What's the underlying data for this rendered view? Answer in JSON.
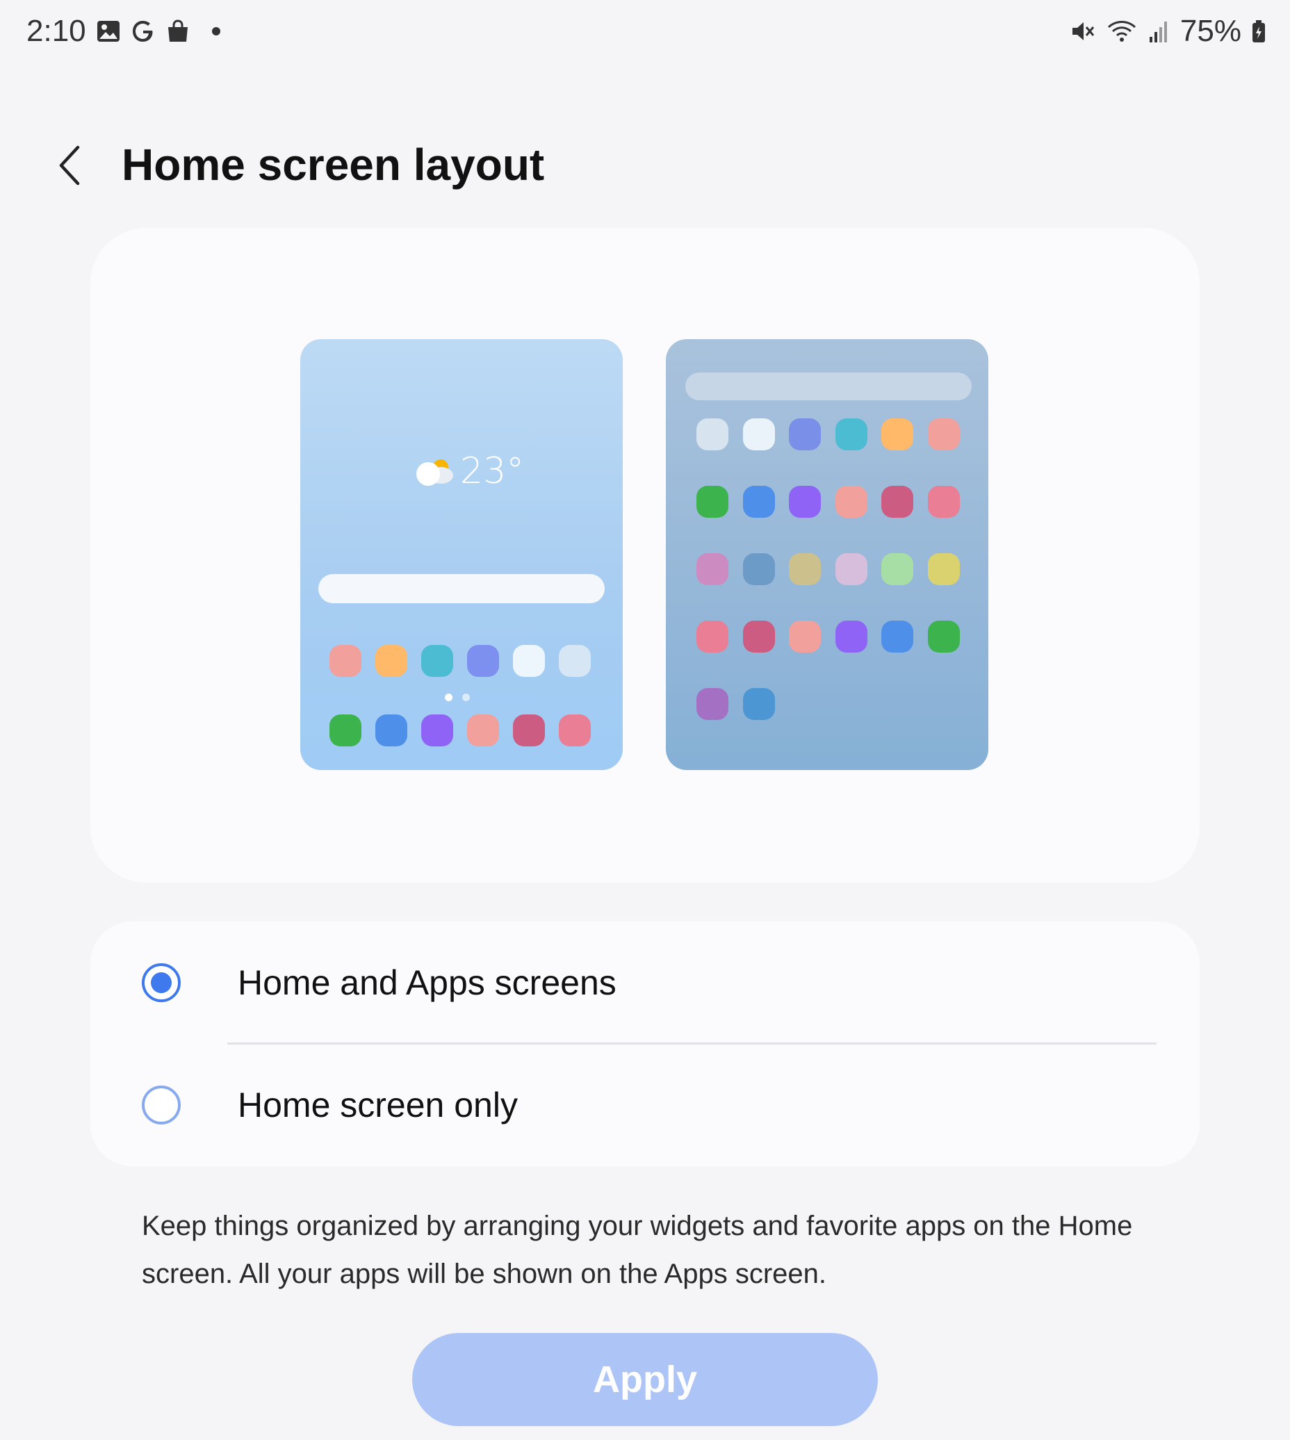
{
  "status_bar": {
    "time": "2:10",
    "left_icons": [
      "gallery-icon",
      "google-icon",
      "shopping-bag-icon",
      "notification-dot-icon"
    ],
    "right_icons": [
      "mute-icon",
      "wifi-icon",
      "signal-icon"
    ],
    "battery": "75%"
  },
  "header": {
    "back_icon": "back-chevron-icon",
    "title": "Home screen layout"
  },
  "preview": {
    "weather_temp": "23°",
    "home_row1_colors": [
      "#f2a09b",
      "#ffb968",
      "#4bbcd2",
      "#7d8fef",
      "#eef6fd",
      "#d6e6f4"
    ],
    "home_row2_colors": [
      "#3cb34d",
      "#4e8fea",
      "#8e63f5",
      "#f2a09b",
      "#cc5c82",
      "#e97e95"
    ],
    "apps_grid_colors": [
      "#d7e4ef",
      "#eaf3fa",
      "#7a8fe8",
      "#4bbcd2",
      "#ffb968",
      "#f2a09b",
      "#3cb34d",
      "#4e8fea",
      "#8e63f5",
      "#f2a09b",
      "#cc5c82",
      "#e97e95",
      "#cc8cc2",
      "#6d9bc8",
      "#ccc08c",
      "#d7bedd",
      "#a7dea5",
      "#dad26e",
      "#e97e95",
      "#cc5c82",
      "#f2a09b",
      "#8e63f5",
      "#4e8fea",
      "#3cb34d",
      "#a470c4",
      "#4c96d4"
    ]
  },
  "options": [
    {
      "label": "Home and Apps screens",
      "selected": true
    },
    {
      "label": "Home screen only",
      "selected": false
    }
  ],
  "description": "Keep things organized by arranging your widgets and favorite apps on the Home screen. All your apps will be shown on the Apps screen.",
  "apply_label": "Apply",
  "colors": {
    "accent": "#3f79ee",
    "apply_button_disabled": "#adc4f7",
    "background": "#f5f5f7",
    "card": "#fbfbfd"
  }
}
